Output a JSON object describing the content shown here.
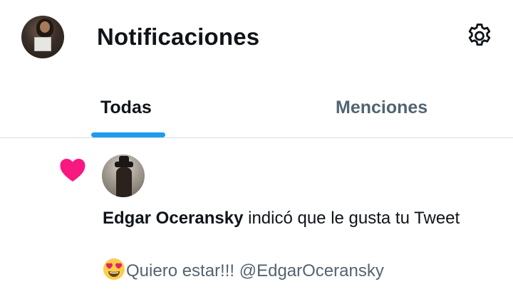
{
  "header": {
    "title": "Notificaciones",
    "avatar_icon": "profile-avatar",
    "settings_icon": "gear-icon"
  },
  "tabs": [
    {
      "label": "Todas",
      "active": true
    },
    {
      "label": "Menciones",
      "active": false
    }
  ],
  "notification": {
    "icon": "heart-icon",
    "icon_color": "#f91880",
    "author": "Edgar Oceransky",
    "action": " indicó que le gusta tu Tweet",
    "tweet_emoji": "heart-eyes-emoji",
    "tweet_text": "Quiero estar!!! @EdgarOceransky"
  },
  "colors": {
    "accent": "#1d9bf0",
    "text_primary": "#0f1419",
    "text_secondary": "#536471",
    "like": "#f91880"
  }
}
